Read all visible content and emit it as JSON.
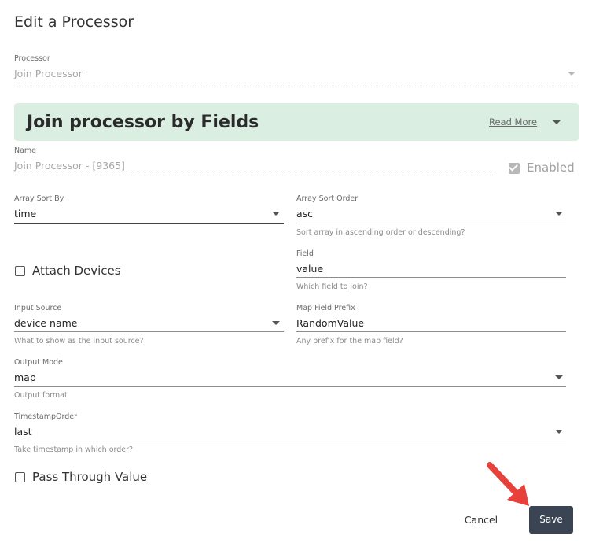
{
  "dialog": {
    "title": "Edit a Processor"
  },
  "processor": {
    "label": "Processor",
    "value": "Join Processor"
  },
  "banner": {
    "title": "Join processor by Fields",
    "read_more": "Read More"
  },
  "name_field": {
    "label": "Name",
    "value": "Join Processor  - [9365]"
  },
  "enabled": {
    "label": "Enabled",
    "checked": true
  },
  "array_sort_by": {
    "label": "Array Sort By",
    "value": "time"
  },
  "array_sort_order": {
    "label": "Array Sort Order",
    "value": "asc",
    "helper": "Sort array in ascending order or descending?"
  },
  "attach_devices": {
    "label": "Attach Devices",
    "checked": false
  },
  "field": {
    "label": "Field",
    "value": "value",
    "helper": "Which field to join?"
  },
  "input_source": {
    "label": "Input Source",
    "value": "device name",
    "helper": "What to show as the input source?"
  },
  "map_field_prefix": {
    "label": "Map Field Prefix",
    "value": "RandomValue",
    "helper": "Any prefix for the map field?"
  },
  "output_mode": {
    "label": "Output Mode",
    "value": "map",
    "helper": "Output format"
  },
  "timestamp_order": {
    "label": "TimestampOrder",
    "value": "last",
    "helper": "Take timestamp in which order?"
  },
  "pass_through": {
    "label": "Pass Through Value",
    "checked": false
  },
  "actions": {
    "cancel": "Cancel",
    "save": "Save"
  },
  "colors": {
    "banner_bg": "#dbeee2",
    "save_bg": "#3a4452",
    "annotation_arrow": "#e8413b"
  }
}
